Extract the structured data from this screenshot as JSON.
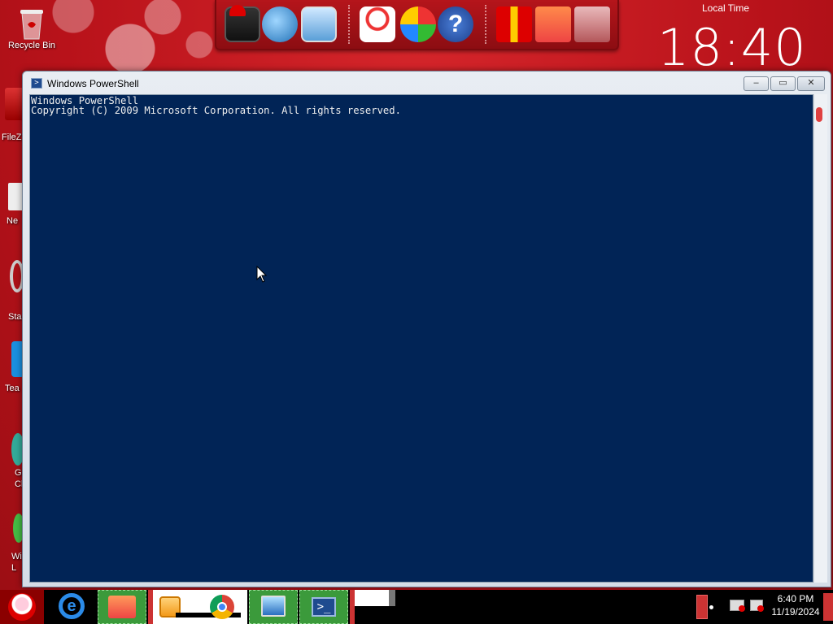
{
  "desktop": {
    "icons": [
      {
        "label": "Recycle Bin"
      }
    ],
    "partial_labels": [
      "FileZ",
      "Ne",
      "Sta",
      "Tea",
      "G\nCl",
      "Wi\nL"
    ]
  },
  "dock": {
    "items": [
      "computer-icon",
      "network-globe-icon",
      "control-panel-icon",
      "snowman-icon",
      "windows-logo-icon",
      "help-icon",
      "gift-box-icon",
      "folder-icon",
      "recycle-bin-icon"
    ]
  },
  "local_clock": {
    "label": "Local Time",
    "time": "18:40"
  },
  "window": {
    "title": "Windows PowerShell",
    "minimize": "–",
    "maximize": "▭",
    "close": "✕",
    "console_lines": [
      "Windows PowerShell",
      "Copyright (C) 2009 Microsoft Corporation. All rights reserved."
    ],
    "colors": {
      "console_bg": "#012456",
      "console_fg": "#eeeeee"
    }
  },
  "taskbar": {
    "items": [
      "start-santa-icon",
      "internet-explorer-icon",
      "file-manager-icon",
      "media-player-icon",
      "chrome-icon",
      "remote-desktop-icon",
      "powershell-icon"
    ],
    "clock_time": "6:40 PM",
    "clock_date": "11/19/2024"
  }
}
